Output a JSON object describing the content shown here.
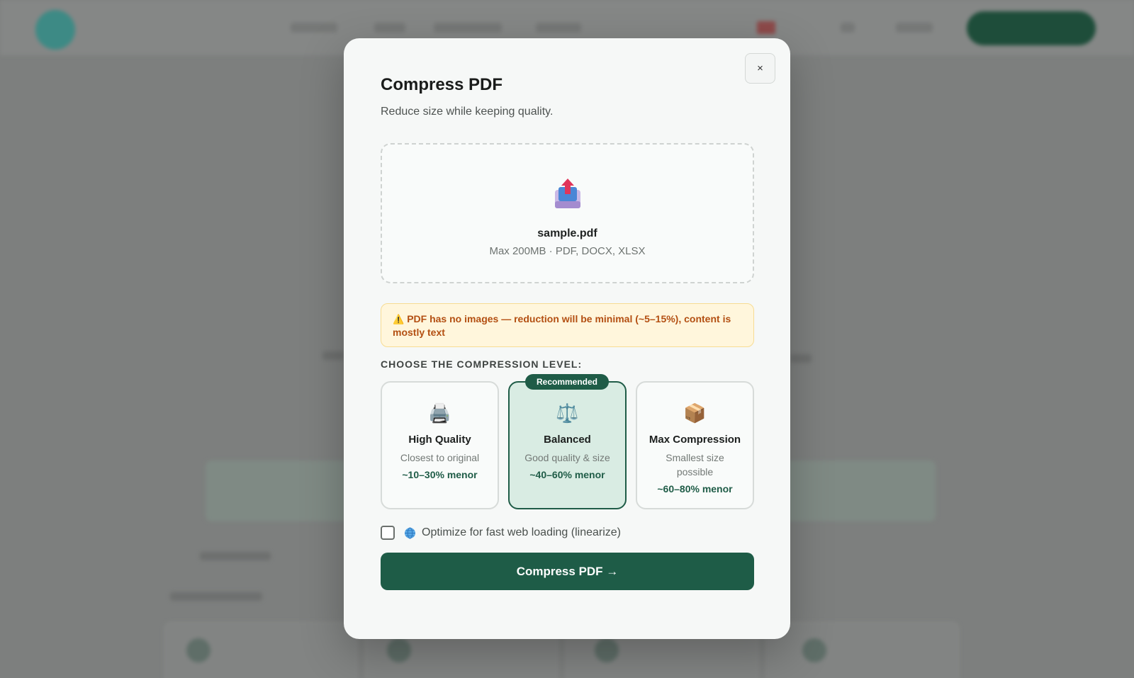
{
  "modal": {
    "title": "Compress PDF",
    "subtitle": "Reduce size while keeping quality.",
    "close_label": "×",
    "dropzone": {
      "icon": "upload-tray-icon",
      "file_name": "sample.pdf",
      "hint": "Max 200MB · PDF, DOCX, XLSX"
    },
    "warning": {
      "icon": "⚠️",
      "text": "PDF has no images — reduction will be minimal (~5–15%), content is mostly text"
    },
    "section_label": "CHOOSE THE COMPRESSION LEVEL:",
    "levels": [
      {
        "icon": "🖨️",
        "icon_name": "printer-icon",
        "title": "High Quality",
        "description": "Closest to original",
        "saving": "~10–30% menor",
        "selected": false
      },
      {
        "icon": "⚖️",
        "icon_name": "balance-scale-icon",
        "title": "Balanced",
        "description": "Good quality & size",
        "saving": "~40–60% menor",
        "selected": true,
        "badge": "Recommended"
      },
      {
        "icon": "📦",
        "icon_name": "package-icon",
        "title": "Max Compression",
        "description": "Smallest size possible",
        "saving": "~60–80% menor",
        "selected": false
      }
    ],
    "option": {
      "checked": false,
      "label": "Optimize for fast web loading (linearize)"
    },
    "submit_label": "Compress PDF →"
  },
  "colors": {
    "accent": "#1e5c47",
    "selected_card_bg": "#d9ece3",
    "warning_bg": "#fff6dc",
    "warning_text": "#b34f12"
  }
}
